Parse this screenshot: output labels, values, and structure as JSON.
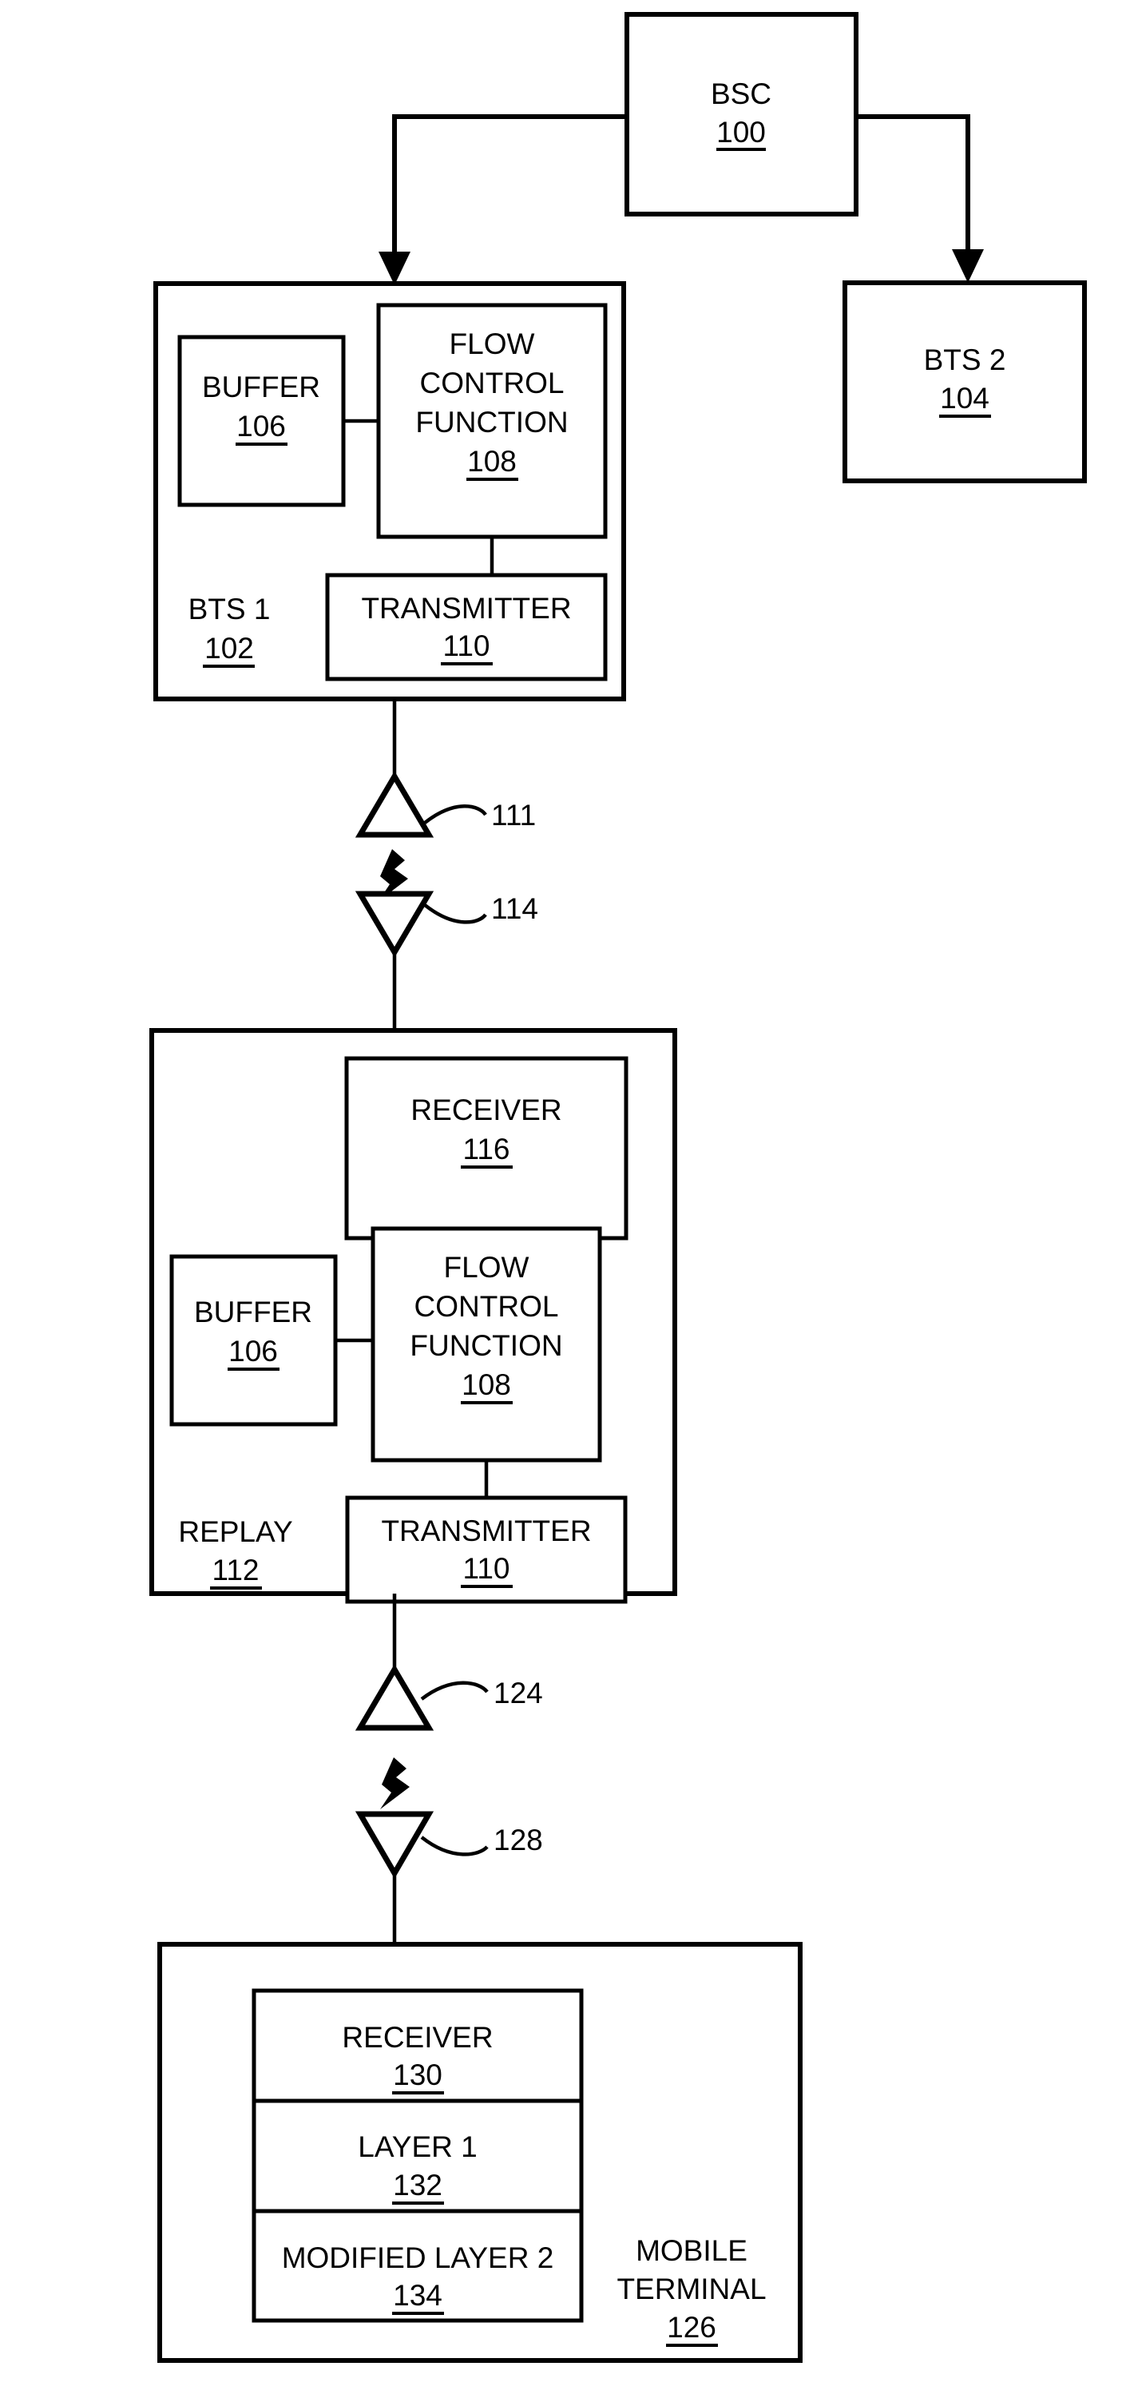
{
  "figure": {
    "type": "patent-block-diagram",
    "title": "Wireless network block diagram with BSC, BTS, replay node and mobile terminal"
  },
  "nodes": {
    "bsc": {
      "label": "BSC",
      "number": "100"
    },
    "bts1": {
      "label": "BTS 1",
      "number": "102"
    },
    "bts2": {
      "label": "BTS 2",
      "number": "104"
    },
    "bts1_buffer": {
      "label": "BUFFER",
      "number": "106"
    },
    "bts1_fcf": {
      "line1": "FLOW",
      "line2": "CONTROL",
      "line3": "FUNCTION",
      "number": "108"
    },
    "bts1_transmitter": {
      "label": "TRANSMITTER",
      "number": "110"
    },
    "replay": {
      "label": "REPLAY",
      "number": "112"
    },
    "replay_receiver": {
      "label": "RECEIVER",
      "number": "116"
    },
    "replay_buffer": {
      "label": "BUFFER",
      "number": "106"
    },
    "replay_fcf": {
      "line1": "FLOW",
      "line2": "CONTROL",
      "line3": "FUNCTION",
      "number": "108"
    },
    "replay_transmitter": {
      "label": "TRANSMITTER",
      "number": "110"
    },
    "mobile_terminal": {
      "line1": "MOBILE",
      "line2": "TERMINAL",
      "number": "126"
    },
    "mt_receiver": {
      "label": "RECEIVER",
      "number": "130"
    },
    "mt_layer1": {
      "label": "LAYER 1",
      "number": "132"
    },
    "mt_layer2": {
      "label": "MODIFIED LAYER 2",
      "number": "134"
    }
  },
  "antennas": {
    "bts1_tx": {
      "ref": "111",
      "orientation": "up"
    },
    "replay_rx": {
      "ref": "114",
      "orientation": "down"
    },
    "replay_tx": {
      "ref": "124",
      "orientation": "up"
    },
    "mt_rx": {
      "ref": "128",
      "orientation": "down"
    }
  },
  "colors": {
    "line": "#000000",
    "fill": "#ffffff",
    "text": "#000000"
  }
}
